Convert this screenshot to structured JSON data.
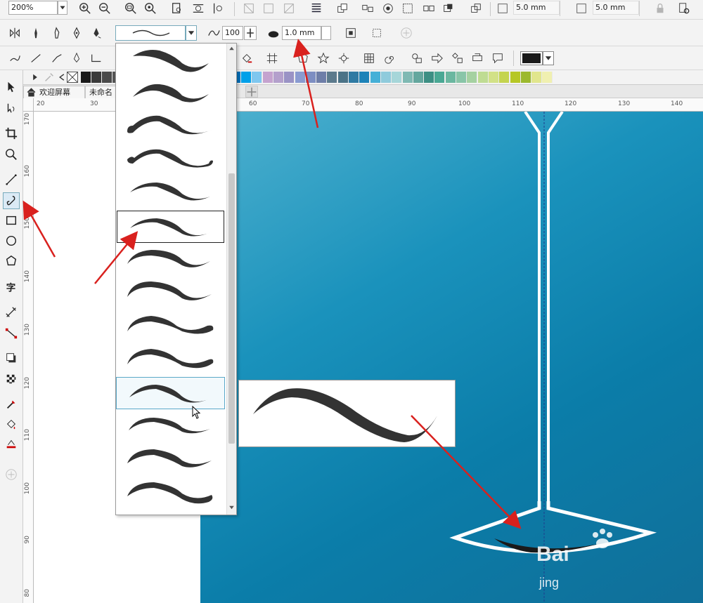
{
  "toolbar_top": {
    "zoom_value": "200%",
    "nudge_width": "5.0 mm",
    "nudge_height": "5.0 mm"
  },
  "property_bar": {
    "smoothing_value": "100",
    "stroke_width_value": "1.0 mm"
  },
  "document_tabs": {
    "welcome_label": "欢迎屏幕",
    "untitled_label": "未命名"
  },
  "ruler_top": {
    "ticks": [
      "20",
      "30",
      "60",
      "70",
      "80",
      "90",
      "100",
      "110",
      "120",
      "130",
      "140"
    ]
  },
  "ruler_left": {
    "ticks": [
      "170",
      "160",
      "150",
      "140",
      "130",
      "120",
      "110",
      "100",
      "90",
      "80"
    ]
  },
  "palette_colors": [
    "#1a1a1a",
    "#3a3a3a",
    "#4a4a4a",
    "#555555",
    "#666666",
    "#ffffff",
    "#ffe600",
    "#f0a500",
    "#e2001a",
    "#e6007e",
    "#a8006e",
    "#7a1f8f",
    "#5e2b8c",
    "#2b3990",
    "#0072bc",
    "#00a0e9",
    "#7fc7ef",
    "#c5a3cf",
    "#b4a0cc",
    "#9a93c5",
    "#8a9bd1",
    "#7d8ec2",
    "#6e7ea8",
    "#5c7a8c",
    "#4b7387",
    "#2f7aa3",
    "#1d83b8",
    "#45b0d7",
    "#8fcbdc",
    "#a6d6d9",
    "#7fb9b3",
    "#64a79e",
    "#3d8f84",
    "#4aa894",
    "#6bb7a0",
    "#89c5a8",
    "#a5d1a1",
    "#bfdc93",
    "#d2e187",
    "#c4d44f",
    "#b6c725",
    "#9cb92e",
    "#e1e68d",
    "#f0f0b0"
  ],
  "line_color_swatch": "#1a1a1a",
  "watermark": {
    "brand": "Bai",
    "sub": "jing"
  }
}
